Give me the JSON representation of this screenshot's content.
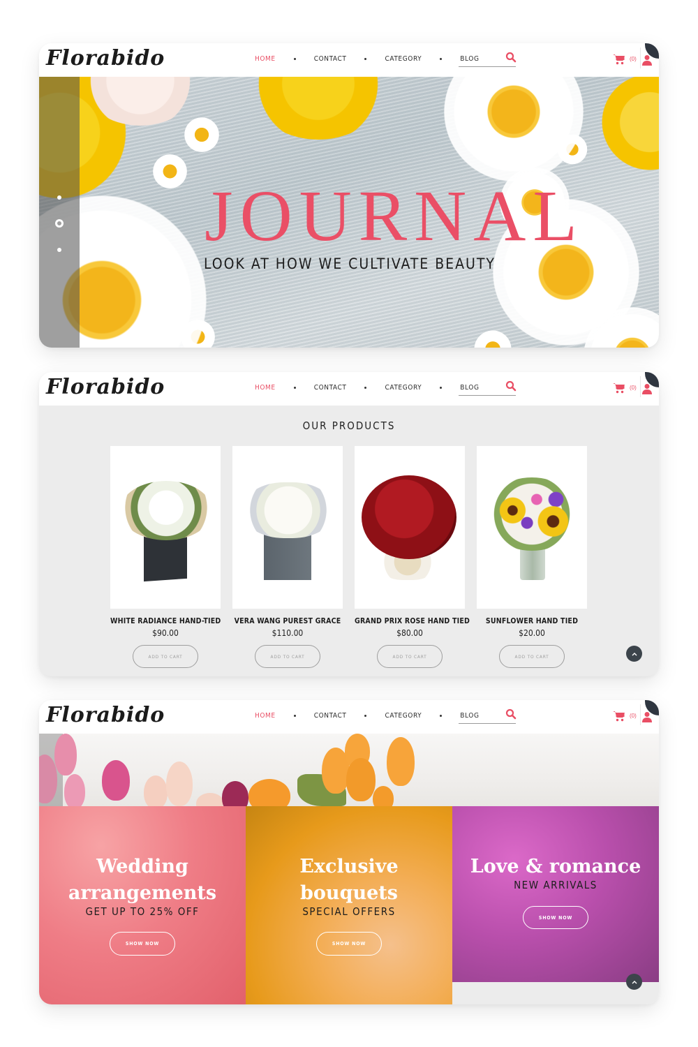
{
  "brand": {
    "logo": "Florabido",
    "accent_color": "#e94e64",
    "dark_color": "#2f3640"
  },
  "nav": {
    "items": [
      {
        "label": "HOME",
        "active": true
      },
      {
        "label": "CONTACT",
        "active": false
      },
      {
        "label": "CATEGORY",
        "active": false
      },
      {
        "label": "BLOG",
        "active": false
      }
    ],
    "search_placeholder": "",
    "cart_count": "(0)",
    "icons": [
      "search-icon",
      "cart-icon",
      "user-icon"
    ]
  },
  "hero": {
    "title": "JOURNAL",
    "subtitle": "LOOK AT HOW WE CULTIVATE BEAUTY",
    "slides": 3,
    "active_slide": 2
  },
  "products_section": {
    "title": "OUR PRODUCTS",
    "add_to_cart_label": "ADD TO CART",
    "items": [
      {
        "name": "WHITE RADIANCE HAND-TIED",
        "price": "$90.00",
        "image": "white lily bouquet in dark gift box"
      },
      {
        "name": "VERA WANG PUREST GRACE",
        "price": "$110.00",
        "image": "white rose bouquet in grey box"
      },
      {
        "name": "GRAND PRIX ROSE HAND TIED",
        "price": "$80.00",
        "image": "red rose dome bouquet"
      },
      {
        "name": "SUNFLOWER HAND TIED",
        "price": "$20.00",
        "image": "sunflower mixed bouquet in glass vase"
      }
    ]
  },
  "promos": [
    {
      "title_line1": "Wedding",
      "title_line2": "arrangements",
      "subtitle": "GET UP TO 25% OFF",
      "button": "SHOW NOW"
    },
    {
      "title_line1": "Exclusive",
      "title_line2": "bouquets",
      "subtitle": "SPECIAL OFFERS",
      "button": "SHOW NOW"
    },
    {
      "title_line1": "Love & romance",
      "subtitle": "NEW ARRIVALS",
      "button": "SHOW NOW"
    }
  ],
  "back_to_top": "chevron-up-icon"
}
